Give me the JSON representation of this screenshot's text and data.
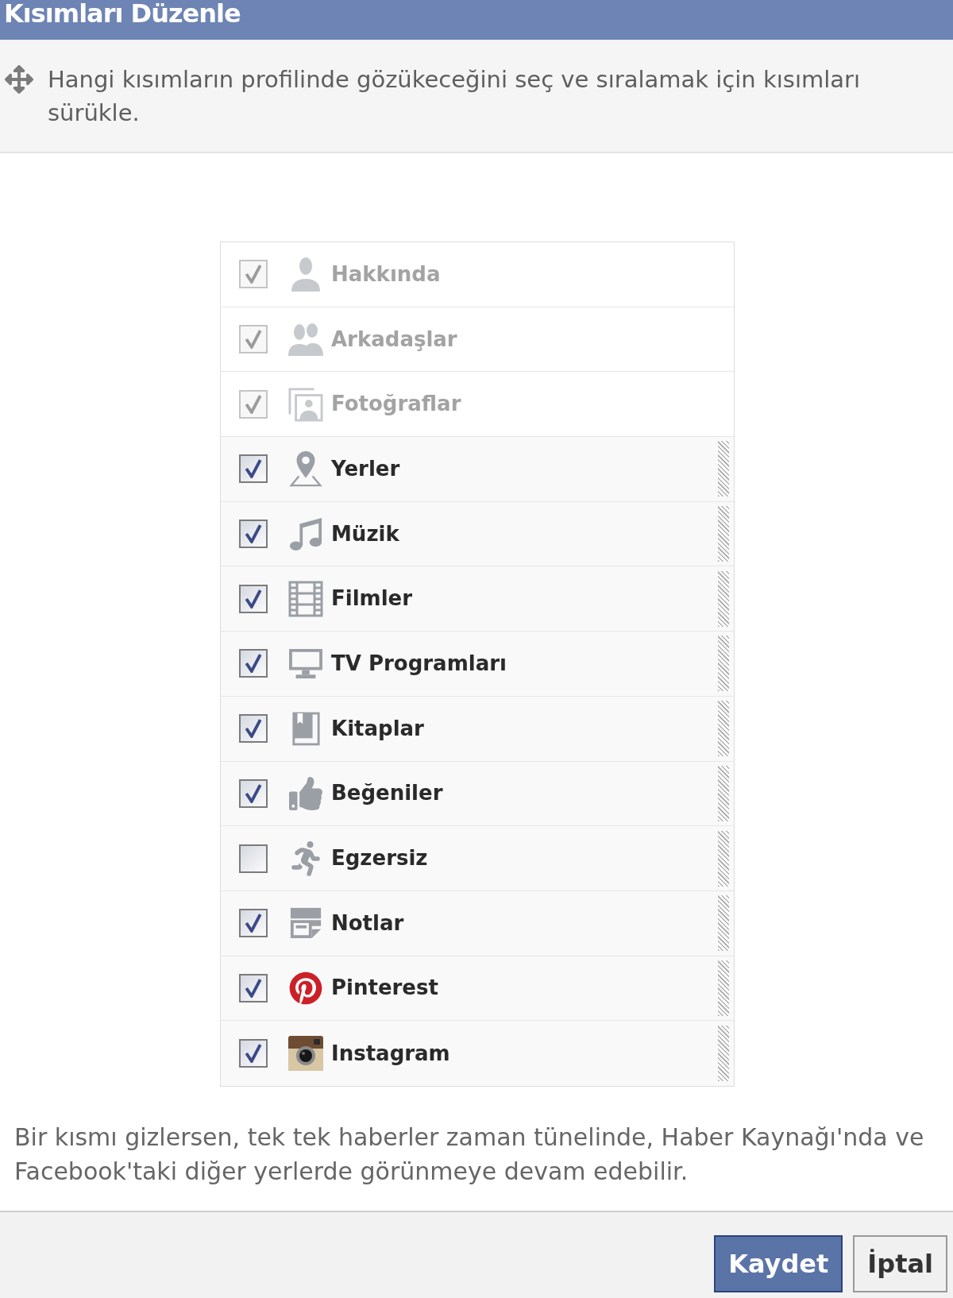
{
  "dialog": {
    "title": "Kısımları Düzenle"
  },
  "instruction": "Hangi kısımların profilinde gözükeceğini seç ve sıralamak için kısımları sürükle.",
  "sections": [
    {
      "label": "Hakkında",
      "checked": true,
      "disabled": true
    },
    {
      "label": "Arkadaşlar",
      "checked": true,
      "disabled": true
    },
    {
      "label": "Fotoğraflar",
      "checked": true,
      "disabled": true
    },
    {
      "label": "Yerler",
      "checked": true,
      "disabled": false
    },
    {
      "label": "Müzik",
      "checked": true,
      "disabled": false
    },
    {
      "label": "Filmler",
      "checked": true,
      "disabled": false
    },
    {
      "label": "TV Programları",
      "checked": true,
      "disabled": false
    },
    {
      "label": "Kitaplar",
      "checked": true,
      "disabled": false
    },
    {
      "label": "Beğeniler",
      "checked": true,
      "disabled": false
    },
    {
      "label": "Egzersiz",
      "checked": false,
      "disabled": false
    },
    {
      "label": "Notlar",
      "checked": true,
      "disabled": false
    },
    {
      "label": "Pinterest",
      "checked": true,
      "disabled": false
    },
    {
      "label": "Instagram",
      "checked": true,
      "disabled": false
    }
  ],
  "note": "Bir kısmı gizlersen, tek tek haberler zaman tünelinde, Haber Kaynağı'nda ve Facebook'taki diğer yerlerde görünmeye devam edebilir.",
  "buttons": [
    {
      "label": "Kaydet",
      "kind": "primary"
    },
    {
      "label": "İptal",
      "kind": "secondary"
    }
  ]
}
